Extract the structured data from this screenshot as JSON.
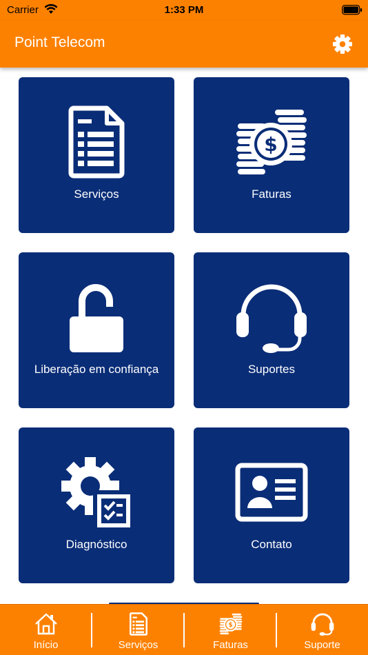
{
  "status_bar": {
    "carrier": "Carrier",
    "time": "1:33 PM"
  },
  "header": {
    "title": "Point Telecom",
    "settings_icon": "gear-icon"
  },
  "tiles": [
    {
      "label": "Serviços",
      "icon": "document-list-icon"
    },
    {
      "label": "Faturas",
      "icon": "coins-dollar-icon"
    },
    {
      "label": "Liberação em confiança",
      "icon": "unlocked-padlock-icon"
    },
    {
      "label": "Suportes",
      "icon": "headset-icon"
    },
    {
      "label": "Diagnóstico",
      "icon": "gear-checklist-icon"
    },
    {
      "label": "Contato",
      "icon": "contact-card-icon"
    }
  ],
  "tab_bar": {
    "items": [
      {
        "label": "Início",
        "icon": "home-icon"
      },
      {
        "label": "Serviços",
        "icon": "document-list-icon"
      },
      {
        "label": "Faturas",
        "icon": "coins-dollar-icon"
      },
      {
        "label": "Suporte",
        "icon": "headset-icon"
      }
    ]
  },
  "colors": {
    "brand_orange": "#fd8100",
    "tile_blue": "#0a2d77",
    "text_white": "#ffffff"
  }
}
